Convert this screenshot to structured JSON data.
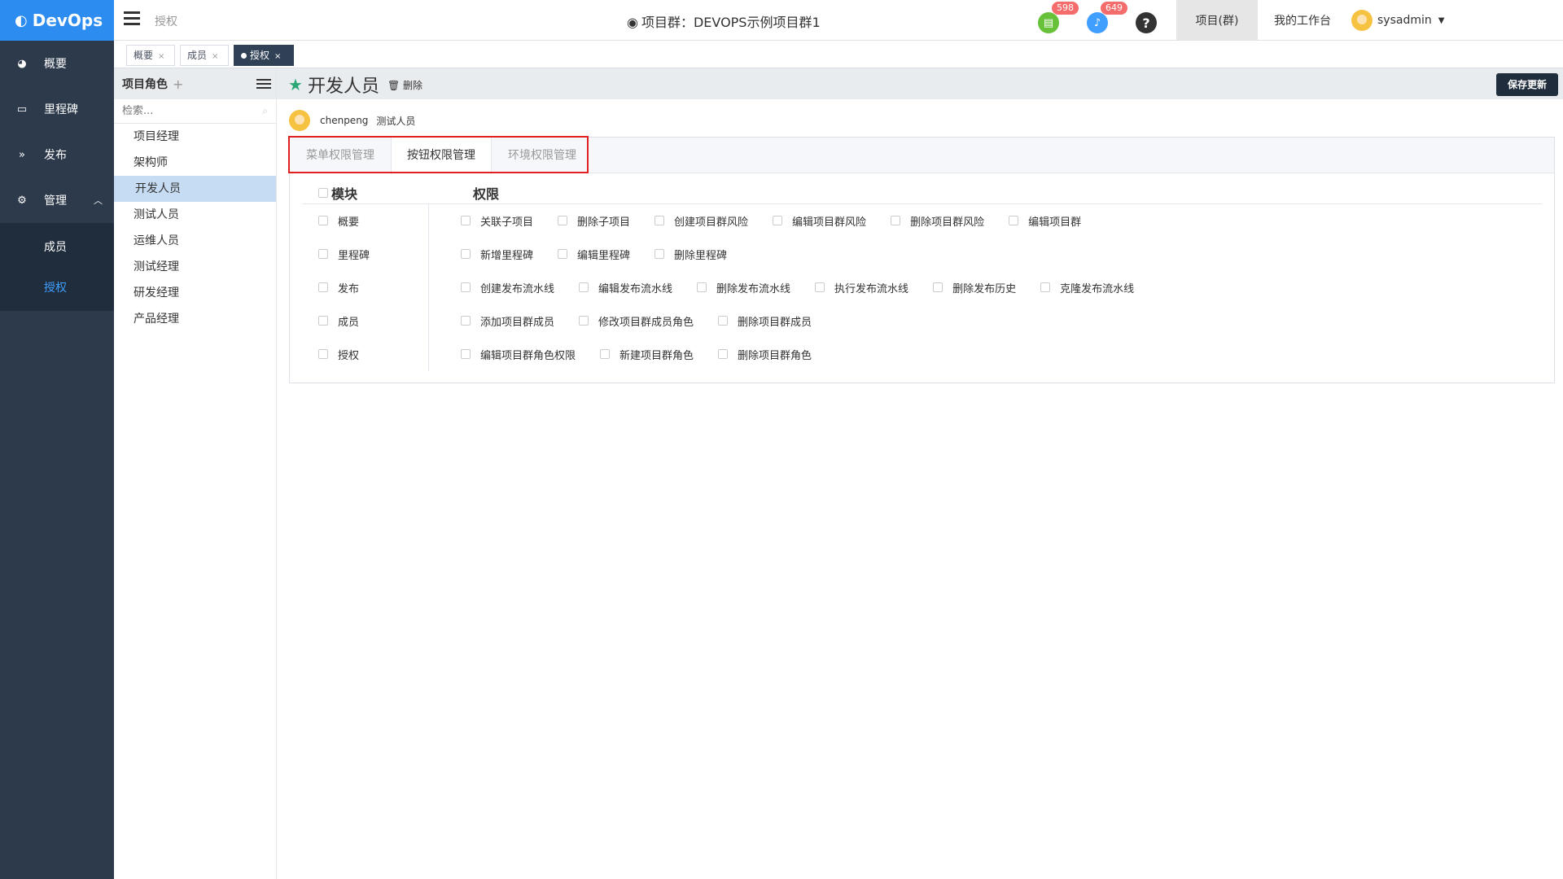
{
  "app": {
    "logo": "DevOps"
  },
  "sidebar": {
    "items": [
      {
        "label": "概要"
      },
      {
        "label": "里程碑"
      },
      {
        "label": "发布"
      },
      {
        "label": "管理"
      }
    ],
    "sub_items": [
      {
        "label": "成员"
      },
      {
        "label": "授权"
      }
    ]
  },
  "header": {
    "breadcrumb": "授权",
    "project_title": "项目群：DEVOPS示例项目群1",
    "badge_tasks": "598",
    "badge_notifications": "649",
    "help": "?",
    "tab_project": "项目(群)",
    "tab_workspace": "我的工作台",
    "user": "sysadmin"
  },
  "tags": [
    {
      "label": "概要"
    },
    {
      "label": "成员"
    },
    {
      "label": "授权"
    }
  ],
  "roles": {
    "title": "项目角色",
    "search_placeholder": "检索...",
    "items": [
      {
        "label": "项目经理"
      },
      {
        "label": "架构师"
      },
      {
        "label": "开发人员"
      },
      {
        "label": "测试人员"
      },
      {
        "label": "运维人员"
      },
      {
        "label": "测试经理"
      },
      {
        "label": "研发经理"
      },
      {
        "label": "产品经理"
      }
    ],
    "selected": "开发人员"
  },
  "main": {
    "role_title": "开发人员",
    "delete_label": "删除",
    "save_label": "保存更新",
    "member_name": "chenpeng",
    "member_role": "测试人员"
  },
  "perm_tabs": [
    {
      "label": "菜单权限管理"
    },
    {
      "label": "按钮权限管理"
    },
    {
      "label": "环境权限管理"
    }
  ],
  "perm_table": {
    "col_module": "模块",
    "col_perm": "权限",
    "rows": [
      {
        "module": "概要",
        "perms": [
          "关联子项目",
          "删除子项目",
          "创建项目群风险",
          "编辑项目群风险",
          "删除项目群风险",
          "编辑项目群"
        ]
      },
      {
        "module": "里程碑",
        "perms": [
          "新增里程碑",
          "编辑里程碑",
          "删除里程碑"
        ]
      },
      {
        "module": "发布",
        "perms": [
          "创建发布流水线",
          "编辑发布流水线",
          "删除发布流水线",
          "执行发布流水线",
          "删除发布历史",
          "克隆发布流水线"
        ]
      },
      {
        "module": "成员",
        "perms": [
          "添加项目群成员",
          "修改项目群成员角色",
          "删除项目群成员"
        ]
      },
      {
        "module": "授权",
        "perms": [
          "编辑项目群角色权限",
          "新建项目群角色",
          "删除项目群角色"
        ]
      }
    ]
  },
  "colors": {
    "accent": "#2d8cf0",
    "sidebar_bg": "#2d3a4b",
    "highlight": "#e02020",
    "star": "#2aa876"
  }
}
